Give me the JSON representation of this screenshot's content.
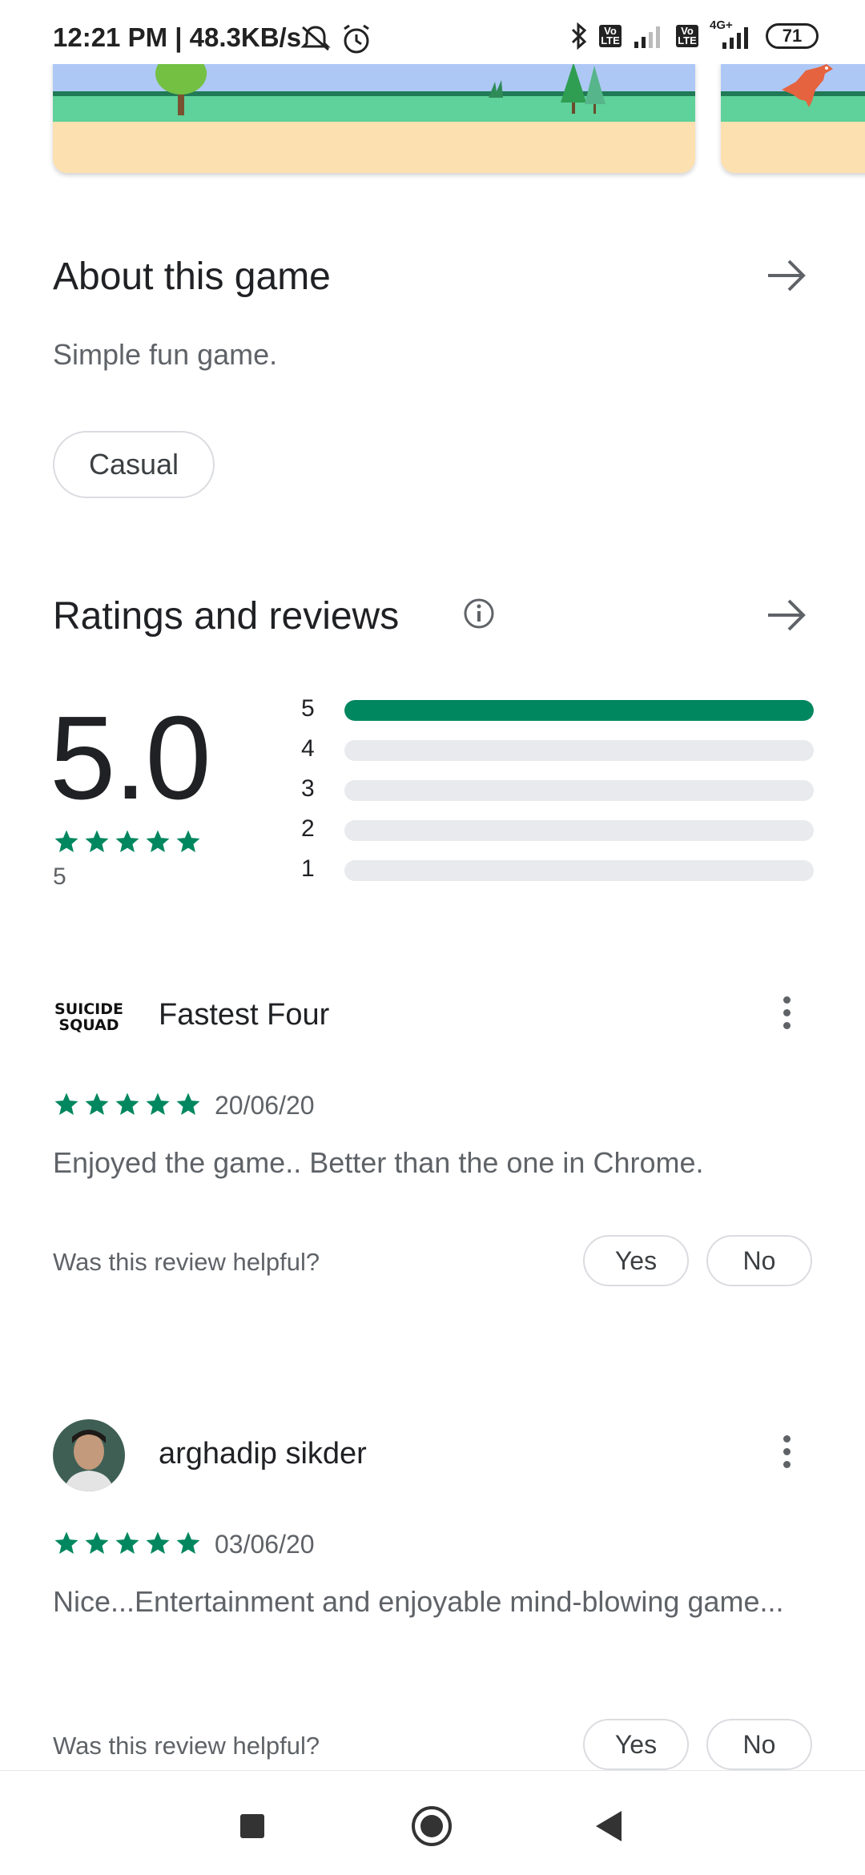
{
  "status_bar": {
    "time": "12:21 PM | 48.3KB/s",
    "lte1": "Vo LTE",
    "lte2": "Vo LTE",
    "network": "4G+",
    "battery": "71",
    "icons": [
      "mute-icon",
      "alarm-icon",
      "bluetooth-icon",
      "signal-icon",
      "signal-icon"
    ]
  },
  "about": {
    "title": "About this game",
    "description": "Simple fun game.",
    "tag": "Casual"
  },
  "ratings": {
    "title": "Ratings and reviews",
    "average": "5.0",
    "count": "5",
    "stars": 5,
    "accent_color": "#01875f",
    "distribution": [
      {
        "label": "5",
        "fraction": 1.0
      },
      {
        "label": "4",
        "fraction": 0.0
      },
      {
        "label": "3",
        "fraction": 0.0
      },
      {
        "label": "2",
        "fraction": 0.0
      },
      {
        "label": "1",
        "fraction": 0.0
      }
    ]
  },
  "reviews": [
    {
      "name": "Fastest Four",
      "avatar_text": "SUICIDE SQUAD",
      "stars": 5,
      "date": "20/06/20",
      "text": "Enjoyed the game.. Better than the one in Chrome.",
      "helpful_prompt": "Was this review helpful?",
      "yes": "Yes",
      "no": "No"
    },
    {
      "name": "arghadip sikder",
      "stars": 5,
      "date": "03/06/20",
      "text": "Nice...Entertainment and enjoyable mind-blowing game...",
      "helpful_prompt": "Was this review helpful?",
      "yes": "Yes",
      "no": "No"
    }
  ]
}
